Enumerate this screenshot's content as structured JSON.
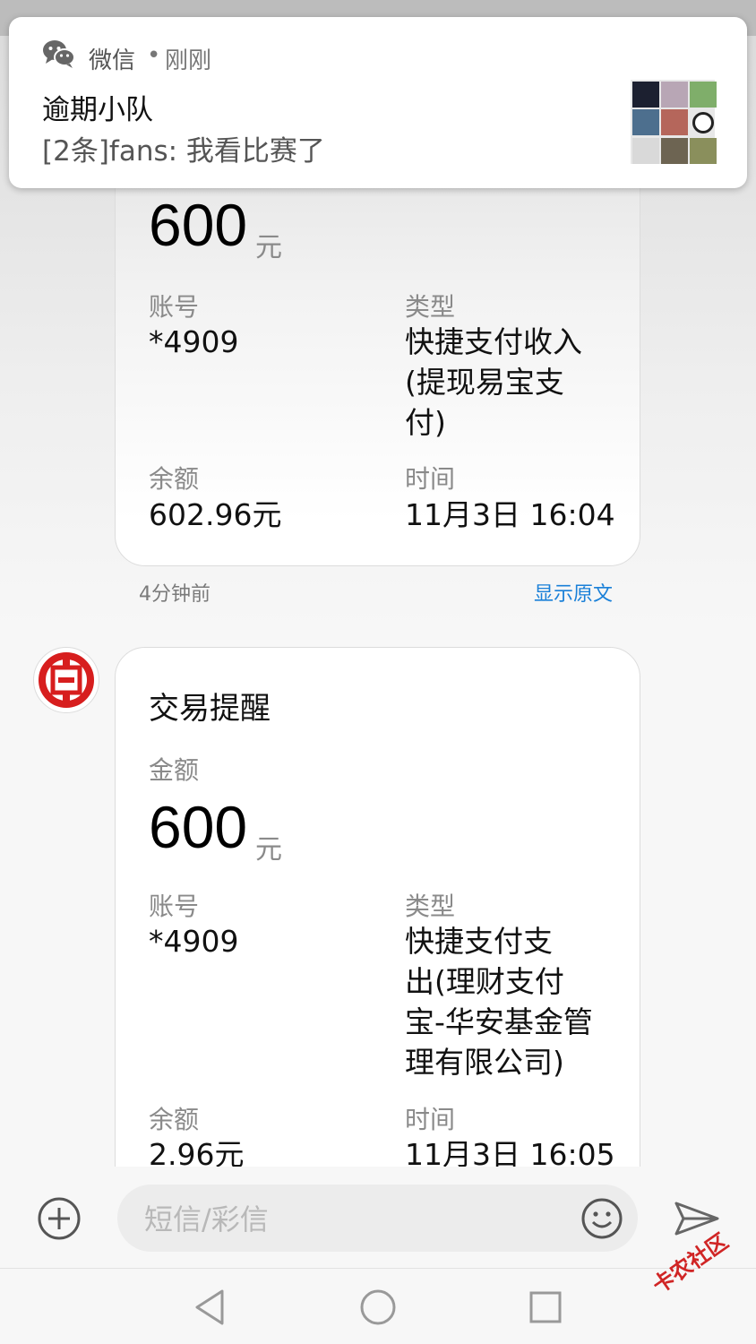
{
  "notification": {
    "app_name": "微信",
    "separator": "•",
    "time": "刚刚",
    "title": "逾期小队",
    "body": "[2条]fans: 我看比赛了"
  },
  "messages": [
    {
      "amount": "600",
      "amount_unit": "元",
      "account_label": "账号",
      "account_value": "*4909",
      "type_label": "类型",
      "type_lines": [
        "快捷支付收入",
        "(提现易宝支",
        "付)"
      ],
      "balance_label": "余额",
      "balance_value": "602.96元",
      "time_label": "时间",
      "time_value": "11月3日 16:04",
      "sent_ago": "4分钟前",
      "show_original": "显示原文"
    },
    {
      "title": "交易提醒",
      "amount_label": "金额",
      "amount": "600",
      "amount_unit": "元",
      "account_label": "账号",
      "account_value": "*4909",
      "type_label": "类型",
      "type_lines": [
        "快捷支付支",
        "出(理财支付",
        "宝-华安基金管",
        "理有限公司)"
      ],
      "balance_label": "余额",
      "balance_value": "2.96元",
      "time_label": "时间",
      "time_value": "11月3日 16:05"
    }
  ],
  "input": {
    "placeholder": "短信/彩信"
  },
  "watermark": "卡农社区",
  "colors": {
    "link": "#1a80d8",
    "bank_red": "#d71e1e",
    "wechat_icon": "#666666"
  }
}
